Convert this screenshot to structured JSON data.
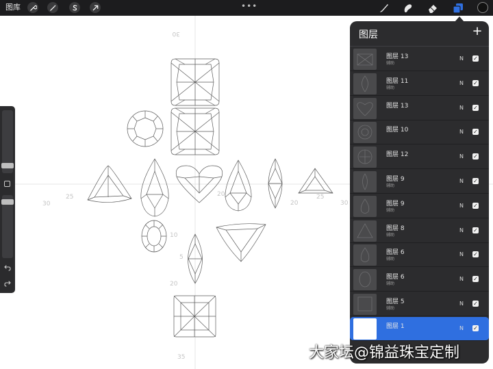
{
  "topbar": {
    "gallery_label": "图库",
    "left_tools": [
      "wrench-icon",
      "magic-wand-icon",
      "selection-s-icon",
      "transform-arrow-icon"
    ],
    "more_dots": "•••",
    "right_tools": [
      "brush-icon",
      "smudge-icon",
      "eraser-icon",
      "layers-icon"
    ],
    "active_tool": "layers-icon",
    "accent_color": "#2f6fe0",
    "current_color": "#111111"
  },
  "canvas": {
    "ruler_labels": [
      "30",
      "30",
      "25",
      "20",
      "10",
      "5",
      "20",
      "20",
      "25",
      "30",
      "35"
    ]
  },
  "layers_panel": {
    "title": "图层",
    "add_label": "+",
    "layers": [
      {
        "name": "图层 13",
        "sub": "辅助",
        "blend": "N",
        "visible": true,
        "selected": false
      },
      {
        "name": "图层 11",
        "sub": "辅助",
        "blend": "N",
        "visible": true,
        "selected": false
      },
      {
        "name": "图层 13",
        "sub": "",
        "blend": "N",
        "visible": true,
        "selected": false
      },
      {
        "name": "图层 10",
        "sub": "",
        "blend": "N",
        "visible": true,
        "selected": false
      },
      {
        "name": "图层 12",
        "sub": "",
        "blend": "N",
        "visible": true,
        "selected": false
      },
      {
        "name": "图层 9",
        "sub": "辅助",
        "blend": "N",
        "visible": true,
        "selected": false
      },
      {
        "name": "图层 9",
        "sub": "辅助",
        "blend": "N",
        "visible": true,
        "selected": false
      },
      {
        "name": "图层 8",
        "sub": "辅助",
        "blend": "N",
        "visible": true,
        "selected": false
      },
      {
        "name": "图层 6",
        "sub": "辅助",
        "blend": "N",
        "visible": true,
        "selected": false
      },
      {
        "name": "图层 6",
        "sub": "辅助",
        "blend": "N",
        "visible": true,
        "selected": false
      },
      {
        "name": "图层 5",
        "sub": "辅助",
        "blend": "N",
        "visible": true,
        "selected": false
      },
      {
        "name": "图层 1",
        "sub": "",
        "blend": "N",
        "visible": true,
        "selected": true
      }
    ]
  },
  "watermark": "大家坛@锦益珠宝定制"
}
